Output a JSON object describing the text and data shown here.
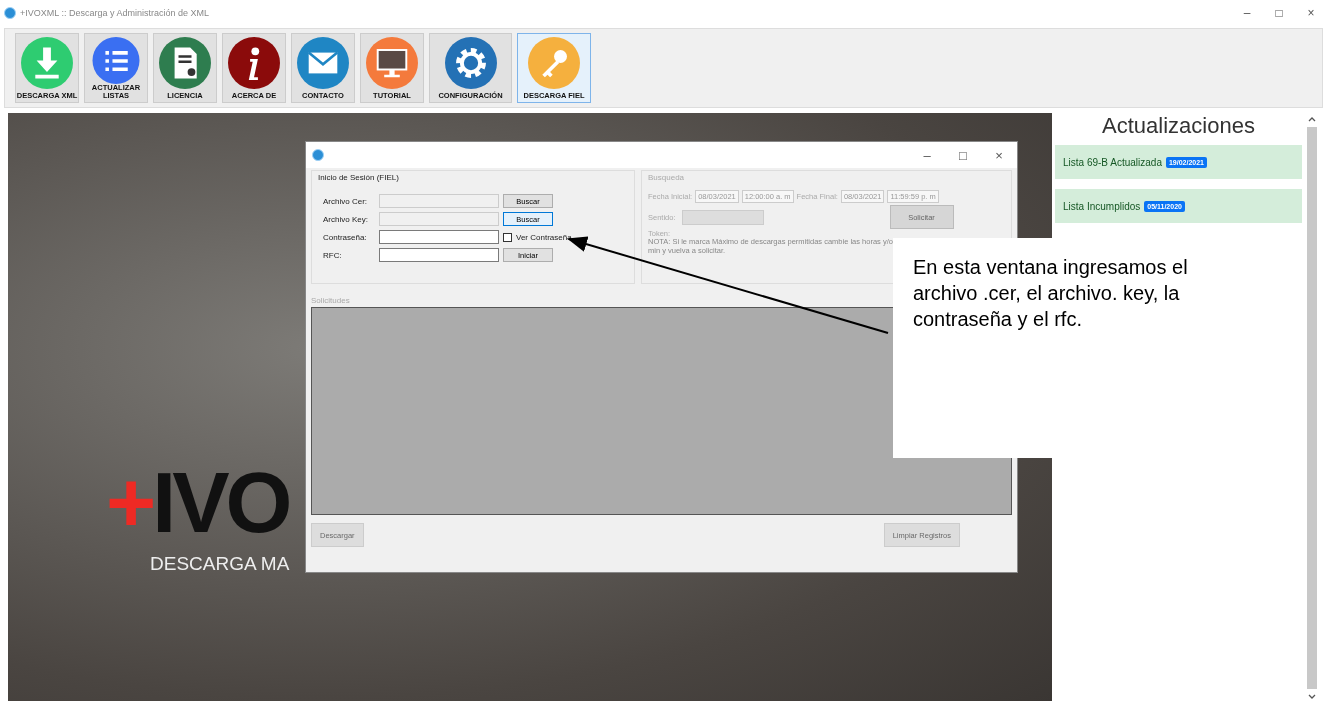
{
  "window": {
    "title": "+IVOXML :: Descarga y Administración de XML",
    "controls": [
      "–",
      "□",
      "×"
    ]
  },
  "toolbar": [
    {
      "label": "DESCARGA XML",
      "kind": "download",
      "color": "#2ecc71",
      "selected": false
    },
    {
      "label": "ACTUALIZAR LISTAS",
      "kind": "list",
      "color": "#3a6ff2",
      "selected": false
    },
    {
      "label": "LICENCIA",
      "kind": "certificate",
      "color": "#2e7d4f",
      "selected": false
    },
    {
      "label": "ACERCA DE",
      "kind": "info",
      "color": "#8b0b0b",
      "selected": false
    },
    {
      "label": "CONTACTO",
      "kind": "mail",
      "color": "#1f86c4",
      "selected": false
    },
    {
      "label": "TUTORIAL",
      "kind": "monitor",
      "color": "#f47a3c",
      "selected": false
    },
    {
      "label": "CONFIGURACIÓN",
      "kind": "gear",
      "color": "#2471b5",
      "selected": false
    },
    {
      "label": "DESCARGA FIEL",
      "kind": "key",
      "color": "#f5b03e",
      "selected": true
    }
  ],
  "background": {
    "logo": "+IVO",
    "subtitle": "DESCARGA MA"
  },
  "dialog": {
    "controls": [
      "–",
      "□",
      "×"
    ],
    "login": {
      "title": "Inicio de Sesión (FIEL)",
      "fields": [
        {
          "label": "Archivo Cer:",
          "disabled": true,
          "kind": "button",
          "button": "Buscar",
          "focused": false
        },
        {
          "label": "Archivo Key:",
          "disabled": true,
          "kind": "button",
          "button": "Buscar",
          "focused": true
        },
        {
          "label": "Contraseña:",
          "disabled": false,
          "kind": "checkbox",
          "checkbox": "Ver Contraseña",
          "checked": false
        },
        {
          "label": "RFC:",
          "disabled": false,
          "kind": "button",
          "button": "Iniciar",
          "focused": false
        }
      ]
    },
    "search": {
      "title": "Busqueda",
      "disabled": true,
      "start_label": "Fecha Inicial:",
      "start_date": "08/03/2021",
      "start_time": "12:00:00 a. m",
      "end_label": "Fecha Final:",
      "end_date": "08/03/2021",
      "end_time": "11:59:59 p. m",
      "request_button": "Solicitar",
      "direction_label": "Sentido:",
      "token_label": "Token:",
      "note": "NOTA: Si le marca Máximo de descargas permitidas cambie las horas y/o min y vuelva a solicitar."
    },
    "requests": {
      "title": "Solicitudes"
    },
    "buttons": [
      {
        "label": "Descargar",
        "disabled": true
      },
      {
        "label": "Limpiar Registros",
        "disabled": true
      }
    ]
  },
  "callout": {
    "text": "En esta ventana ingresamos el archivo .cer, el archivo. key, la contraseña y el rfc."
  },
  "updates": {
    "title": "Actualizaciones",
    "items": [
      {
        "label": "Lista 69-B Actualizada",
        "date": "19/02/2021"
      },
      {
        "label": "Lista Incumplidos",
        "date": "05/11/2020"
      }
    ]
  }
}
